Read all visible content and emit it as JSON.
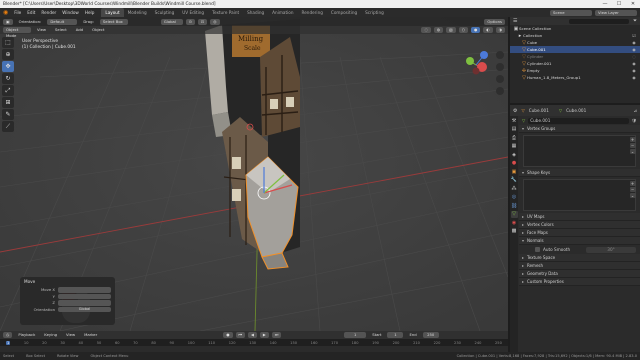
{
  "window": {
    "title": "Blender* [C:\\Users\\User\\Desktop\\3DWorld Courses\\Windmill\\Blender Builds\\Windmill Course.blend]",
    "minimize": "—",
    "maximize": "☐",
    "close": "✕"
  },
  "menu": {
    "items": [
      "File",
      "Edit",
      "Render",
      "Window",
      "Help"
    ],
    "workspaces": [
      "Layout",
      "Modeling",
      "Sculpting",
      "UV Editing",
      "Texture Paint",
      "Shading",
      "Animation",
      "Rendering",
      "Compositing",
      "Scripting"
    ],
    "active_workspace": "Layout",
    "scene_label": "Scene",
    "view_layer_label": "View Layer"
  },
  "viewport_header": {
    "mode": "Object Mode",
    "view": "View",
    "select": "Select",
    "add": "Add",
    "object": "Object",
    "orientation_label": "Orientation:",
    "orientation_value": "Default",
    "drag_label": "Drag:",
    "drag_value": "Select Box",
    "transform_value": "Global",
    "options": "Options"
  },
  "viewport_info": {
    "line1": "User Perspective",
    "line2": "(1) Collection | Cube.001"
  },
  "operator_panel": {
    "title": "Move",
    "fields": [
      {
        "label": "Move X",
        "value": ""
      },
      {
        "label": "Y",
        "value": ""
      },
      {
        "label": "Z",
        "value": ""
      },
      {
        "label": "Orientation",
        "value": "Global"
      }
    ]
  },
  "timeline": {
    "playback": "Playback",
    "keying": "Keying",
    "view": "View",
    "marker": "Marker",
    "current_frame": "1",
    "start_label": "Start",
    "start": "1",
    "end_label": "End",
    "end": "250",
    "ruler": [
      "1",
      "10",
      "20",
      "30",
      "40",
      "50",
      "60",
      "70",
      "80",
      "90",
      "100",
      "110",
      "120",
      "130",
      "140",
      "150",
      "160",
      "170",
      "180",
      "190",
      "200",
      "210",
      "220",
      "230",
      "240",
      "250"
    ]
  },
  "statusbar": {
    "left": "Select",
    "mid1": "Box Select",
    "mid2": "Rotate View",
    "mid3": "Object Context Menu",
    "right": "Collection | Cube.001 | Verts:8,168 | Faces:7,928 | Tris:15,692 | Objects:1/6 | Mem: 90.4 MiB | 2.83.0"
  },
  "outliner": {
    "title": "Scene Collection",
    "items": [
      {
        "name": "Collection",
        "icon": "collection-icon",
        "indent": 1,
        "selected": false
      },
      {
        "name": "Cube",
        "icon": "mesh-icon",
        "indent": 2,
        "selected": false
      },
      {
        "name": "Cube.001",
        "icon": "mesh-icon",
        "indent": 2,
        "selected": true
      },
      {
        "name": "Cylinder",
        "icon": "mesh-icon",
        "indent": 2,
        "selected": false
      },
      {
        "name": "Cylinder.001",
        "icon": "mesh-icon",
        "indent": 2,
        "selected": false
      },
      {
        "name": "Empty",
        "icon": "empty-icon",
        "indent": 2,
        "selected": false
      },
      {
        "name": "Human_1.8_Meters_Group1",
        "icon": "mesh-icon",
        "indent": 2,
        "selected": false
      }
    ]
  },
  "properties": {
    "breadcrumb_left": "Cube.001",
    "breadcrumb_right": "Cube.001",
    "data_name": "Cube.001",
    "sections": [
      {
        "name": "Vertex Groups",
        "open": true
      },
      {
        "name": "Shape Keys",
        "open": true
      },
      {
        "name": "UV Maps",
        "open": false
      },
      {
        "name": "Vertex Colors",
        "open": false
      },
      {
        "name": "Face Maps",
        "open": false
      },
      {
        "name": "Normals",
        "open": true
      },
      {
        "name": "Texture Space",
        "open": false
      },
      {
        "name": "Remesh",
        "open": false
      },
      {
        "name": "Geometry Data",
        "open": false
      },
      {
        "name": "Custom Properties",
        "open": false
      }
    ],
    "auto_smooth_label": "Auto Smooth",
    "auto_smooth_value": "30°"
  },
  "colors": {
    "accent": "#4772b3",
    "selected": "#334d80",
    "orange_outline": "#f0902a",
    "viewport_bg": "#3d3d3d"
  }
}
